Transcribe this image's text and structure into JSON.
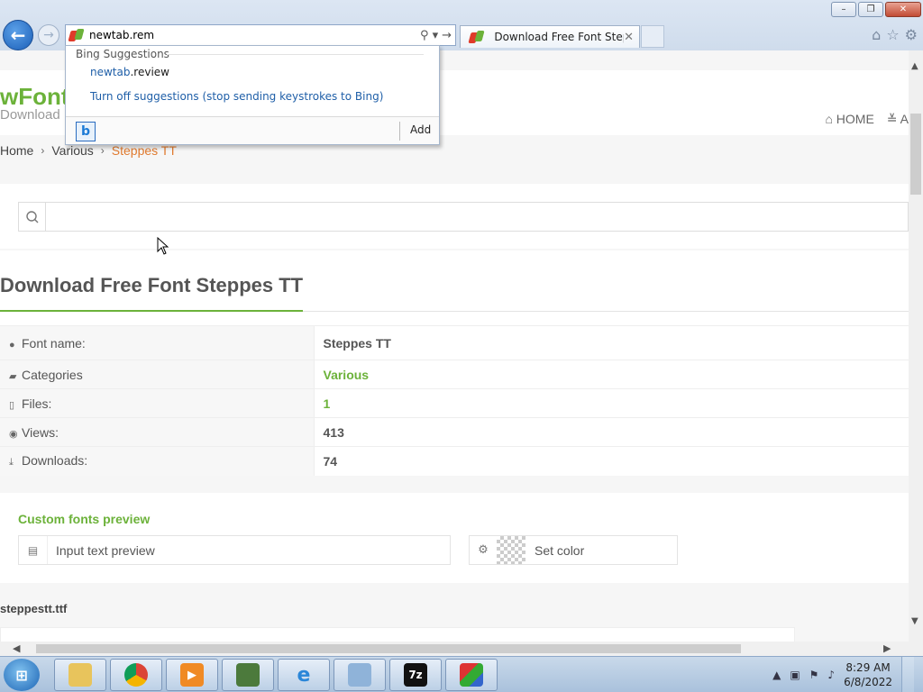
{
  "browser": {
    "address_value": "newtab.rem",
    "tab_title": "Download Free Font Stepp...",
    "window_buttons": {
      "minimize": "–",
      "maximize": "❐",
      "close": "✕"
    }
  },
  "suggestions": {
    "header": "Bing Suggestions",
    "item_highlight": "newtab",
    "item_rest": ".review",
    "turn_off": "Turn off suggestions (stop sending keystrokes to Bing)",
    "add_label": "Add",
    "bing_letter": "b"
  },
  "site": {
    "logo": "wFont",
    "logo_sub": "Download",
    "nav": {
      "home": "HOME",
      "next": "A"
    }
  },
  "breadcrumb": {
    "home": "Home",
    "category": "Various",
    "current": "Steppes TT"
  },
  "search": {
    "placeholder": ""
  },
  "font": {
    "title": "Download Free Font Steppes TT",
    "rows": [
      {
        "label": "Font name:",
        "value": "Steppes TT",
        "icon": "info-circle-icon"
      },
      {
        "label": "Categories",
        "value": "Various",
        "icon": "briefcase-icon"
      },
      {
        "label": "Files:",
        "value": "1",
        "icon": "file-icon"
      },
      {
        "label": "Views:",
        "value": "413",
        "icon": "eye-icon"
      },
      {
        "label": "Downloads:",
        "value": "74",
        "icon": "download-icon"
      }
    ]
  },
  "preview": {
    "title": "Custom fonts preview",
    "input_placeholder": "Input text preview",
    "set_color": "Set color"
  },
  "file": {
    "name": "steppestt.ttf"
  },
  "taskbar": {
    "time": "8:29 AM",
    "date": "6/8/2022"
  },
  "colors": {
    "accent_green": "#6cb23a",
    "crumb_orange": "#e07a2e",
    "ie_blue": "#1b5fb8"
  }
}
